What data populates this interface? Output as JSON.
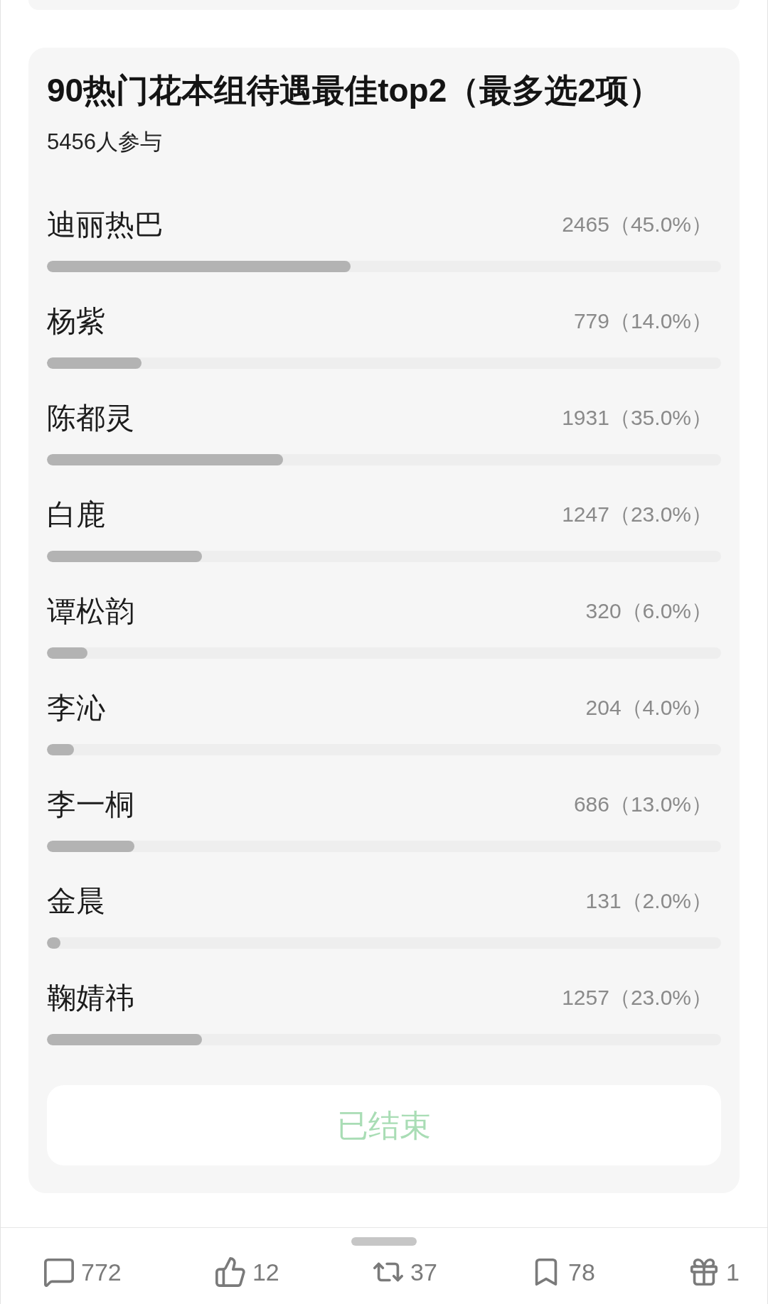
{
  "poll": {
    "title": "90热门花本组待遇最佳top2（最多选2项）",
    "participants": "5456人参与",
    "options": [
      {
        "name": "迪丽热巴",
        "result": "2465（45.0%）",
        "level": 0.45
      },
      {
        "name": "杨紫",
        "result": "779（14.0%）",
        "level": 0.14
      },
      {
        "name": "陈都灵",
        "result": "1931（35.0%）",
        "level": 0.35
      },
      {
        "name": "白鹿",
        "result": "1247（23.0%）",
        "level": 0.23
      },
      {
        "name": "谭松韵",
        "result": "320（6.0%）",
        "level": 0.06
      },
      {
        "name": "李沁",
        "result": "204（4.0%）",
        "level": 0.04
      },
      {
        "name": "李一桐",
        "result": "686（13.0%）",
        "level": 0.13
      },
      {
        "name": "金晨",
        "result": "131（2.0%）",
        "level": 0.02
      },
      {
        "name": "鞠婧祎",
        "result": "1257（23.0%）",
        "level": 0.23
      }
    ],
    "status_button": {
      "label": "已结束",
      "disabled": true
    }
  },
  "action_bar": {
    "items": [
      {
        "kind": "comment",
        "count": "772"
      },
      {
        "kind": "like",
        "count": "12"
      },
      {
        "kind": "repost",
        "count": "37"
      },
      {
        "kind": "bookmark",
        "count": "78"
      },
      {
        "kind": "gift",
        "count": "1"
      }
    ]
  }
}
